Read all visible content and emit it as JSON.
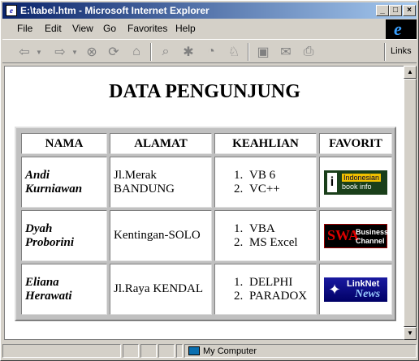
{
  "window": {
    "title": "E:\\tabel.htm - Microsoft Internet Explorer"
  },
  "menu": [
    "File",
    "Edit",
    "View",
    "Go",
    "Favorites",
    "Help"
  ],
  "toolbar": {
    "links_label": "Links"
  },
  "page": {
    "heading": "DATA PENGUNJUNG",
    "headers": [
      "NAMA",
      "ALAMAT",
      "KEAHLIAN",
      "FAVORIT"
    ],
    "rows": [
      {
        "nama": "Andi Kurniawan",
        "alamat": "Jl.Merak BANDUNG",
        "keahlian": [
          "VB 6",
          "VC++"
        ],
        "favorit_logo": "Indonesian book info"
      },
      {
        "nama": "Dyah Proborini",
        "alamat": "Kentingan-SOLO",
        "keahlian": [
          "VBA",
          "MS Excel"
        ],
        "favorit_logo": "SWA Business Channel"
      },
      {
        "nama": "Eliana Herawati",
        "alamat": "Jl.Raya KENDAL",
        "keahlian": [
          "DELPHI",
          "PARADOX"
        ],
        "favorit_logo": "LinkNet News"
      }
    ],
    "logos": {
      "logo1": {
        "line1": "Indonesian",
        "line2": "book info"
      },
      "logo2": {
        "mark": "SWA",
        "line1": "Business",
        "line2": "Channel"
      },
      "logo3": {
        "line1": "LinkNet",
        "line2": "News"
      }
    }
  },
  "status": {
    "zone": "My Computer"
  },
  "colors": {
    "title_start": "#0a246a",
    "title_end": "#a6caf0",
    "chrome": "#d4d0c8"
  }
}
